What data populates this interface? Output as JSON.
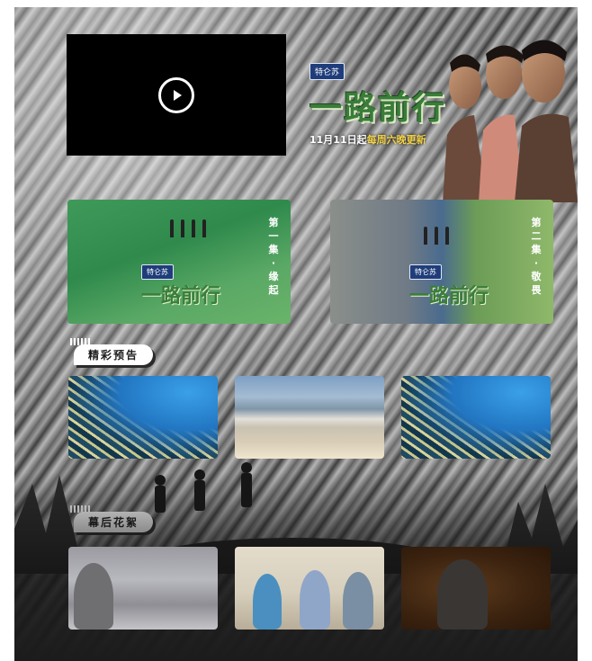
{
  "banner": {
    "brand": "特仑苏",
    "title": "一路前行",
    "update_prefix": "11月11日起",
    "update_highlight": "每周六晚更新"
  },
  "video": {
    "play_icon": "play-icon"
  },
  "episodes": [
    {
      "brand": "特仑苏",
      "title": "一路前行",
      "side_text": "第一集·缘起"
    },
    {
      "brand": "特仑苏",
      "title": "一路前行",
      "side_text": "第二集·敬畏"
    }
  ],
  "sections": {
    "trailers_label": "精彩预告",
    "behind_label": "幕后花絮"
  },
  "colors": {
    "page_background": "#ffffff",
    "accent_green": "#3a7c3a",
    "accent_yellow": "#f3d34a"
  }
}
